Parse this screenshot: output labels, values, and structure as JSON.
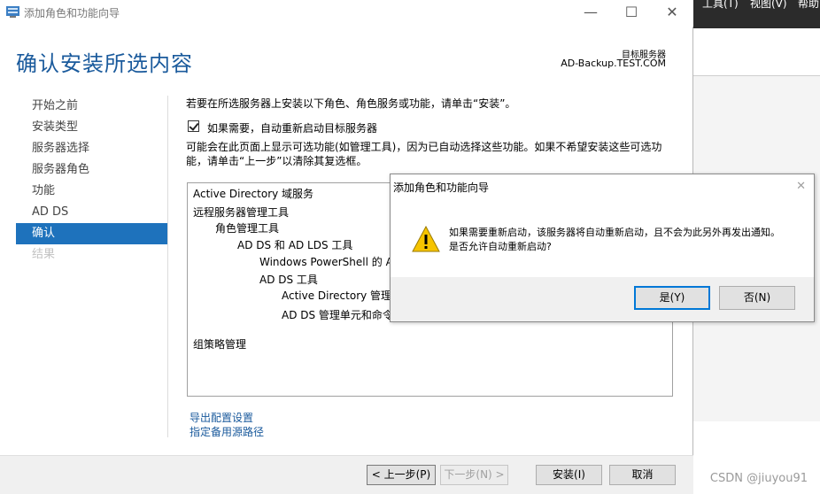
{
  "window": {
    "title": "添加角色和功能向导",
    "page_title": "确认安装所选内容",
    "target_server_label": "目标服务器",
    "target_server_value": "AD-Backup.TEST.COM",
    "controls": {
      "minimize": "—",
      "maximize": "☐",
      "close": "✕"
    }
  },
  "nav": {
    "items": [
      {
        "label": "开始之前",
        "state": "normal"
      },
      {
        "label": "安装类型",
        "state": "normal"
      },
      {
        "label": "服务器选择",
        "state": "normal"
      },
      {
        "label": "服务器角色",
        "state": "normal"
      },
      {
        "label": "功能",
        "state": "normal"
      },
      {
        "label": "AD DS",
        "state": "normal"
      },
      {
        "label": "确认",
        "state": "active"
      },
      {
        "label": "结果",
        "state": "disabled"
      }
    ]
  },
  "content": {
    "instruction": "若要在所选服务器上安装以下角色、角色服务或功能，请单击“安装”。",
    "restart_checkbox_label": "如果需要，自动重新启动目标服务器",
    "restart_checked": true,
    "note": "可能会在此页面上显示可选功能(如管理工具)，因为已自动选择这些功能。如果不希望安装这些可选功能，请单击“上一步”以清除其复选框。",
    "features": [
      {
        "label": "Active Directory 域服务",
        "level": 0
      },
      {
        "label": "远程服务器管理工具",
        "level": 0
      },
      {
        "label": "角色管理工具",
        "level": 1
      },
      {
        "label": "AD DS 和 AD LDS 工具",
        "level": 2
      },
      {
        "label": "Windows PowerShell 的 A",
        "level": 3
      },
      {
        "label": "AD DS 工具",
        "level": 3
      },
      {
        "label": "Active Directory 管理中",
        "level": 4
      },
      {
        "label": "AD DS 管理单元和命令",
        "level": 4
      },
      {
        "label": "组策略管理",
        "level": 0
      }
    ],
    "export_link": "导出配置设置",
    "source_link": "指定备用源路径"
  },
  "footer": {
    "prev": "< 上一步(P)",
    "next": "下一步(N) >",
    "install": "安装(I)",
    "cancel": "取消"
  },
  "dialog": {
    "title": "添加角色和功能向导",
    "close": "✕",
    "icon": "warning-icon",
    "message_line1": "如果需要重新启动，该服务器将自动重新启动，且不会为此另外再发出通知。",
    "message_line2": "是否允许自动重新启动?",
    "yes": "是(Y)",
    "no": "否(N)"
  },
  "background_app": {
    "menu": [
      "工具(T)",
      "视图(V)",
      "帮助"
    ]
  },
  "watermark": "CSDN @jiuyou91",
  "colors": {
    "title_blue": "#1a5a9c",
    "nav_active": "#1e72bc",
    "focus_border": "#0078d7"
  }
}
